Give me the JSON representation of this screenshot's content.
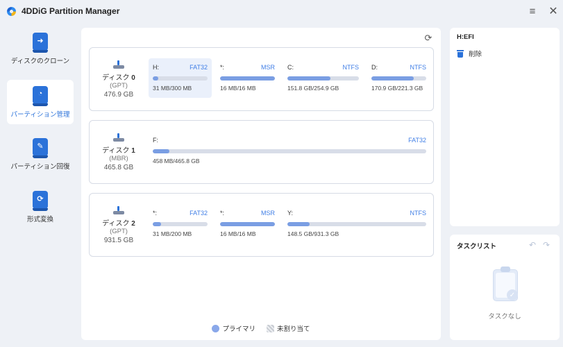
{
  "app": {
    "title": "4DDiG Partition Manager",
    "menu_icon": "hamburger-icon",
    "close_icon": "close-icon"
  },
  "sidebar": {
    "items": [
      {
        "label": "ディスクのクローン",
        "icon": "disk-clone-icon",
        "glyph": "➜",
        "active": false
      },
      {
        "label": "パーティション管理",
        "icon": "partition-manage-icon",
        "glyph": "◔",
        "active": true
      },
      {
        "label": "パーティション回復",
        "icon": "partition-recovery-icon",
        "glyph": "✎",
        "active": false
      },
      {
        "label": "形式変換",
        "icon": "convert-icon",
        "glyph": "⟳",
        "active": false
      }
    ]
  },
  "disks": [
    {
      "name": "ディスク",
      "number": "0",
      "type": "(GPT)",
      "size": "476.9 GB",
      "partitions": [
        {
          "letter": "H:",
          "fs": "FAT32",
          "usage": "31 MB/300 MB",
          "used_fraction": 0.1,
          "selected": true
        },
        {
          "letter": "*:",
          "fs": "MSR",
          "usage": "16 MB/16 MB",
          "used_fraction": 1.0,
          "selected": false
        },
        {
          "letter": "C:",
          "fs": "NTFS",
          "usage": "151.8 GB/254.9 GB",
          "used_fraction": 0.6,
          "selected": false
        },
        {
          "letter": "D:",
          "fs": "NTFS",
          "usage": "170.9 GB/221.3 GB",
          "used_fraction": 0.77,
          "selected": false
        }
      ]
    },
    {
      "name": "ディスク",
      "number": "1",
      "type": "(MBR)",
      "size": "465.8 GB",
      "partitions": [
        {
          "letter": "F:",
          "fs": "FAT32",
          "usage": "458 MB/465.8 GB",
          "used_fraction": 0.02,
          "selected": false
        }
      ]
    },
    {
      "name": "ディスク",
      "number": "2",
      "type": "(GPT)",
      "size": "931.5 GB",
      "partitions": [
        {
          "letter": "*:",
          "fs": "FAT32",
          "usage": "31 MB/200 MB",
          "used_fraction": 0.15,
          "selected": false
        },
        {
          "letter": "*:",
          "fs": "MSR",
          "usage": "16 MB/16 MB",
          "used_fraction": 1.0,
          "selected": false
        },
        {
          "letter": "Y:",
          "fs": "NTFS",
          "usage": "148.5 GB/931.3 GB",
          "used_fraction": 0.16,
          "selected": false
        }
      ]
    }
  ],
  "legend": {
    "primary": "プライマリ",
    "unallocated": "未割り当て"
  },
  "properties": {
    "title": "H:EFI",
    "delete_label": "削除"
  },
  "tasks": {
    "title": "タスクリスト",
    "empty_label": "タスクなし"
  },
  "colors": {
    "accent": "#2b72d9",
    "bar_fill": "#7a9ee3",
    "bar_track": "#d8dde8",
    "fs_label": "#3f7ee6"
  }
}
